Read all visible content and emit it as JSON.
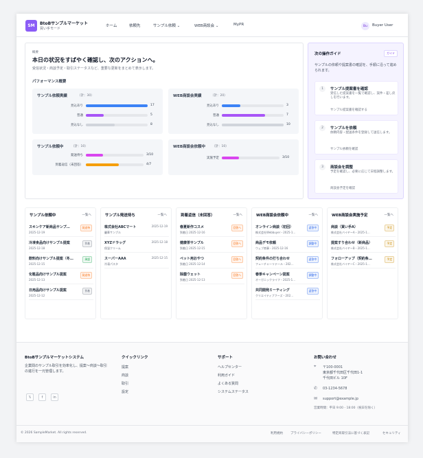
{
  "header": {
    "logo": "SM",
    "brand": "BtoBサンプルマーケット",
    "mode": "買い手モード",
    "nav": [
      "ホーム",
      "依頼先",
      "サンプル依頼 ⌄",
      "WEB商談会 ⌄",
      "MyPR"
    ],
    "avatar": "Bu",
    "user": "Buyer User"
  },
  "overview": {
    "eyebrow": "概要",
    "title": "本日の状況をすばやく確認し、次のアクションへ。",
    "desc": "受信状況・商談予定・取引ステータスなど、重要な更新をまとめて表示します。",
    "section": "パフォーマンス概要"
  },
  "stats": {
    "sample": {
      "title": "サンプル依頼実績",
      "count": "（計：30）",
      "rows": [
        {
          "label": "見込あり",
          "value": "17",
          "pct": 100,
          "color": "#3b82f6"
        },
        {
          "label": "普通",
          "value": "5",
          "pct": 29,
          "color": "#a855f7"
        },
        {
          "label": "見込なし",
          "value": "8",
          "pct": 47,
          "color": "#d1d5db"
        }
      ]
    },
    "web": {
      "title": "WEB商談会実績",
      "count": "（計：20）",
      "rows": [
        {
          "label": "見込あり",
          "value": "3",
          "pct": 30,
          "color": "#3b82f6"
        },
        {
          "label": "普通",
          "value": "7",
          "pct": 70,
          "color": "#a855f7"
        },
        {
          "label": "見込なし",
          "value": "10",
          "pct": 100,
          "color": "#d1d5db"
        }
      ]
    },
    "sample_active": {
      "title": "サンプル依頼中",
      "count": "（計：10）",
      "rows": [
        {
          "label": "発送待ち",
          "value": "3/10",
          "pct": 30,
          "color": "#d946ef"
        },
        {
          "label": "到着返信（未回答）",
          "value": "4/7",
          "pct": 57,
          "color": "#f59e0b"
        }
      ]
    },
    "web_active": {
      "title": "WEB商談会依頼中",
      "count": "（計：10）",
      "rows": [
        {
          "label": "実施予定",
          "value": "3/10",
          "pct": 30,
          "color": "#d946ef"
        }
      ]
    }
  },
  "guide": {
    "title": "次の操作ガイド",
    "badge": "ガイド",
    "desc": "サンプルの依頼や提案書の確認を、手順に沿って進められます。",
    "steps": [
      {
        "num": "1",
        "title": "サンプル提案書を確認",
        "desc": "受信した提案書を一覧で確認し、案件・差し戻しを行います。",
        "link": "サンプル提案書を確認する"
      },
      {
        "num": "2",
        "title": "サンプルを依頼",
        "desc": "依頼内容・配送条件を登録して送信します。",
        "link": "サンプル依頼を確認"
      },
      {
        "num": "3",
        "title": "商談会を調整",
        "desc": "予定を確認し、必要に応じて日程調整します。",
        "link": "商談会予定を確認"
      }
    ]
  },
  "lists": [
    {
      "title": "サンプル依頼中",
      "more": "一覧へ",
      "items": [
        {
          "name": "スキンケア新商品サンプ…",
          "meta": "2025-12-19",
          "date": "",
          "badge": "発送待",
          "color": "#f97316"
        },
        {
          "name": "冷凍食品向けサンプル提案",
          "meta": "2025-12-18",
          "date": "",
          "badge": "到着",
          "color": "#6b7280"
        },
        {
          "name": "飲料向けサンプル提案（冬…",
          "meta": "2025-12-15",
          "date": "",
          "badge": "承認",
          "color": "#16a34a"
        },
        {
          "name": "化粧品向けサンプル提案",
          "meta": "2025-12-13",
          "date": "",
          "badge": "発送待",
          "color": "#f97316"
        },
        {
          "name": "日用品向けサンプル提案",
          "meta": "2025-12-12",
          "date": "",
          "badge": "到着",
          "color": "#6b7280"
        }
      ]
    },
    {
      "title": "サンプル発送待ち",
      "more": "一覧へ",
      "items": [
        {
          "name": "株式会社ABCマート",
          "meta": "麗華サンプル",
          "date": "2025-12-19",
          "badge": "",
          "color": ""
        },
        {
          "name": "XYZドラッグ",
          "meta": "保湿クリーム",
          "date": "2025-12-18",
          "badge": "",
          "color": ""
        },
        {
          "name": "スーパーAAA",
          "meta": "冷凍パスタ",
          "date": "2025-12-15",
          "badge": "",
          "color": ""
        }
      ]
    },
    {
      "title": "到着返信（未回答）",
      "more": "一覧へ",
      "items": [
        {
          "name": "春夏新作コスメ",
          "meta": "到着日 2025-12-16",
          "date": "",
          "badge": "回答へ",
          "color": "#f97316"
        },
        {
          "name": "健康茶サンプル",
          "meta": "到着日 2025-12-15",
          "date": "",
          "badge": "回答へ",
          "color": "#f97316"
        },
        {
          "name": "ペット用おやつ",
          "meta": "到着日 2025-12-14",
          "date": "",
          "badge": "回答へ",
          "color": "#f97316"
        },
        {
          "name": "除菌ウェット",
          "meta": "到着日 2025-12-13",
          "date": "",
          "badge": "回答へ",
          "color": "#f97316"
        }
      ]
    },
    {
      "title": "WEB商談会依頼中",
      "more": "一覧へ",
      "items": [
        {
          "name": "オンライン商談（初回）",
          "meta": "株式会社Webbuyer・2025-1…",
          "date": "",
          "badge": "返答中",
          "color": "#2563eb"
        },
        {
          "name": "商品デモ依頼",
          "meta": "ウェブ商事・2025-12-16",
          "date": "",
          "badge": "調整中",
          "color": "#2563eb"
        },
        {
          "name": "契約条件の打ち合わせ",
          "meta": "フューチャーリテール・202…",
          "date": "",
          "badge": "返答中",
          "color": "#2563eb"
        },
        {
          "name": "春季キャンペーン提案",
          "meta": "オーガニックライフ・2025-1…",
          "date": "",
          "badge": "調整中",
          "color": "#2563eb"
        },
        {
          "name": "共同開発ミーティング",
          "meta": "クリエイティブフーズ・202…",
          "date": "",
          "badge": "返答中",
          "color": "#2563eb"
        }
      ]
    },
    {
      "title": "WEB商談会実施予定",
      "more": "一覧へ",
      "items": [
        {
          "name": "商談（買い手A）",
          "meta": "株式会社バイヤーA・2025-1…",
          "date": "",
          "badge": "予定",
          "color": "#ca8a04"
        },
        {
          "name": "提案すり合わせ（新商品）",
          "meta": "株式会社バイヤーB・2025-1…",
          "date": "",
          "badge": "予定",
          "color": "#ca8a04"
        },
        {
          "name": "フォローアップ（契約条…",
          "meta": "株式会社バイヤーC・2025-1…",
          "date": "",
          "badge": "予定",
          "color": "#ca8a04"
        }
      ]
    }
  ],
  "footer": {
    "brand": "BtoBサンプルマーケットシステム",
    "desc": "企業間のサンプル取引を効率化し、提案〜商談〜取引の進行を一元管理します。",
    "social": [
      "𝕏",
      "f",
      "in"
    ],
    "quick_title": "クイックリンク",
    "quick": [
      "提案",
      "商談",
      "取引",
      "設定"
    ],
    "support_title": "サポート",
    "support": [
      "ヘルプセンター",
      "利用ガイド",
      "よくある質問",
      "システムステータス"
    ],
    "contact_title": "お問い合わせ",
    "postal": "〒100-0001",
    "addr1": "東京都千代田区千代田1-1",
    "addr2": "千代田ビル 10F",
    "phone": "03-1234-5678",
    "email": "support@example.jp",
    "hours": "営業時間：平日 9:00 - 18:00（祝日を除く）",
    "copyright": "© 2026 SampleMarket. All rights reserved.",
    "legal": [
      "利用規約",
      "プライバシーポリシー",
      "特定商取引法に基づく表記",
      "セキュリティ"
    ]
  }
}
